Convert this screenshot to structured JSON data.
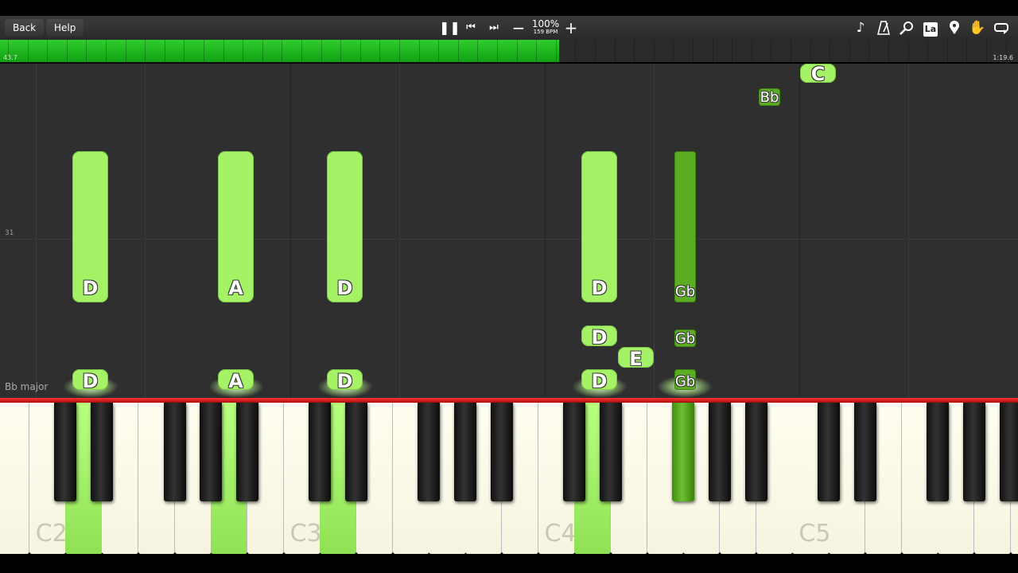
{
  "toolbar": {
    "back_label": "Back",
    "help_label": "Help",
    "tempo_percent": "100%",
    "tempo_bpm": "159 BPM",
    "icons": [
      "pause-icon",
      "skip-back-icon",
      "skip-forward-icon",
      "minus-icon",
      "plus-icon",
      "note-icon",
      "metronome-icon",
      "search-icon",
      "label-icon",
      "location-pin-icon",
      "hand-icon",
      "loop-icon"
    ],
    "label_icon_text": "La"
  },
  "progress": {
    "start_time": "43.7",
    "end_time": "1:19.6",
    "fraction": 0.549,
    "accent": "#22bb22"
  },
  "roll": {
    "measure_number": "31",
    "key_signature": "Bb major",
    "note_color": "#a6f266",
    "dark_note_color": "#5cad22",
    "notes": [
      {
        "label": "D"
      },
      {
        "label": "A"
      },
      {
        "label": "D"
      },
      {
        "label": "D"
      },
      {
        "label": "Gb"
      },
      {
        "label": "D"
      },
      {
        "label": "E"
      },
      {
        "label": "Gb"
      },
      {
        "label": "D"
      },
      {
        "label": "A"
      },
      {
        "label": "D"
      },
      {
        "label": "D"
      },
      {
        "label": "Gb"
      },
      {
        "label": "Bb"
      },
      {
        "label": "C"
      }
    ]
  },
  "keyboard": {
    "labels": [
      "C2",
      "C3",
      "C4",
      "C5"
    ],
    "active_color": "#a6f266"
  }
}
